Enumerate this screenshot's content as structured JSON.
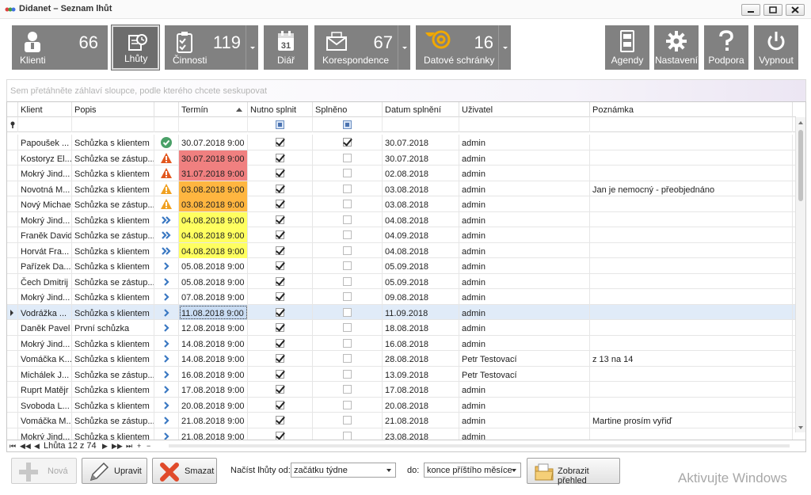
{
  "window": {
    "title": "Didanet – Seznam lhůt"
  },
  "toolbar": {
    "klienti": {
      "label": "Klienti",
      "count": "66"
    },
    "lhuty": {
      "label": "Lhůty"
    },
    "cinnosti": {
      "label": "Činnosti",
      "count": "119"
    },
    "diar": {
      "label": "Diář",
      "day": "31"
    },
    "korespondence": {
      "label": "Korespondence",
      "count": "67"
    },
    "datove": {
      "label": "Datové schránky",
      "count": "16"
    },
    "agendy": {
      "label": "Agendy"
    },
    "nastaveni": {
      "label": "Nastavení"
    },
    "podpora": {
      "label": "Podpora"
    },
    "vypnout": {
      "label": "Vypnout"
    }
  },
  "grid": {
    "group_hint": "Sem přetáhněte záhlaví sloupce, podle kterého chcete seskupovat",
    "columns": {
      "klient": "Klient",
      "popis": "Popis",
      "termin": "Termín",
      "nutno": "Nutno splnit",
      "splneno": "Splněno",
      "datum": "Datum splnění",
      "uzivatel": "Uživatel",
      "poznamka": "Poznámka"
    },
    "rows": [
      {
        "klient": "Papoušek ...",
        "popis": "Schůzka s klientem",
        "status": "done",
        "termin": "30.07.2018 9:00",
        "hl": "",
        "nutno": true,
        "splneno": true,
        "datum": "30.07.2018",
        "uzivatel": "admin",
        "poznamka": ""
      },
      {
        "klient": "Kostoryz El...",
        "popis": "Schůzka se zástup...",
        "status": "overdue",
        "termin": "30.07.2018 9:00",
        "hl": "red",
        "nutno": true,
        "splneno": false,
        "datum": "30.07.2018",
        "uzivatel": "admin",
        "poznamka": ""
      },
      {
        "klient": "Mokrý Jind...",
        "popis": "Schůzka s klientem",
        "status": "overdue",
        "termin": "31.07.2018 9:00",
        "hl": "red",
        "nutno": true,
        "splneno": false,
        "datum": "02.08.2018",
        "uzivatel": "admin",
        "poznamka": ""
      },
      {
        "klient": "Novotná M...",
        "popis": "Schůzka s klientem",
        "status": "warning",
        "termin": "03.08.2018 9:00",
        "hl": "orange",
        "nutno": true,
        "splneno": false,
        "datum": "03.08.2018",
        "uzivatel": "admin",
        "poznamka": "Jan je nemocný - přeobjednáno"
      },
      {
        "klient": "Nový Michael",
        "popis": "Schůzka se zástup...",
        "status": "warning",
        "termin": "03.08.2018 9:00",
        "hl": "orange",
        "nutno": true,
        "splneno": false,
        "datum": "03.08.2018",
        "uzivatel": "admin",
        "poznamka": ""
      },
      {
        "klient": "Mokrý Jind...",
        "popis": "Schůzka s klientem",
        "status": "soon",
        "termin": "04.08.2018 9:00",
        "hl": "yellow",
        "nutno": true,
        "splneno": false,
        "datum": "04.08.2018",
        "uzivatel": "admin",
        "poznamka": ""
      },
      {
        "klient": "Franěk David",
        "popis": "Schůzka se zástup...",
        "status": "soon",
        "termin": "04.08.2018 9:00",
        "hl": "yellow",
        "nutno": true,
        "splneno": false,
        "datum": "04.09.2018",
        "uzivatel": "admin",
        "poznamka": ""
      },
      {
        "klient": "Horvát Fra...",
        "popis": "Schůzka s klientem",
        "status": "soon",
        "termin": "04.08.2018 9:00",
        "hl": "yellow",
        "nutno": true,
        "splneno": false,
        "datum": "04.08.2018",
        "uzivatel": "admin",
        "poznamka": ""
      },
      {
        "klient": "Pařízek Da...",
        "popis": "Schůzka s klientem",
        "status": "future",
        "termin": "05.08.2018 9:00",
        "hl": "",
        "nutno": true,
        "splneno": false,
        "datum": "05.09.2018",
        "uzivatel": "admin",
        "poznamka": ""
      },
      {
        "klient": "Čech Dmitrij",
        "popis": "Schůzka se zástup...",
        "status": "future",
        "termin": "05.08.2018 9:00",
        "hl": "",
        "nutno": true,
        "splneno": false,
        "datum": "05.09.2018",
        "uzivatel": "admin",
        "poznamka": ""
      },
      {
        "klient": "Mokrý Jind...",
        "popis": "Schůzka s klientem",
        "status": "future",
        "termin": "07.08.2018 9:00",
        "hl": "",
        "nutno": true,
        "splneno": false,
        "datum": "09.08.2018",
        "uzivatel": "admin",
        "poznamka": ""
      },
      {
        "klient": "Vodrážka ...",
        "popis": "Schůzka s klientem",
        "status": "future",
        "termin": "11.08.2018 9:00",
        "hl": "focus",
        "nutno": true,
        "splneno": false,
        "datum": "11.09.2018",
        "uzivatel": "admin",
        "poznamka": "",
        "selected": true
      },
      {
        "klient": "Daněk Pavel",
        "popis": "První schůzka",
        "status": "future",
        "termin": "12.08.2018 9:00",
        "hl": "",
        "nutno": true,
        "splneno": false,
        "datum": "18.08.2018",
        "uzivatel": "admin",
        "poznamka": ""
      },
      {
        "klient": "Mokrý Jind...",
        "popis": "Schůzka s klientem",
        "status": "future",
        "termin": "14.08.2018 9:00",
        "hl": "",
        "nutno": true,
        "splneno": false,
        "datum": "16.08.2018",
        "uzivatel": "admin",
        "poznamka": ""
      },
      {
        "klient": "Vomáčka K...",
        "popis": "Schůzka s klientem",
        "status": "future",
        "termin": "14.08.2018 9:00",
        "hl": "",
        "nutno": true,
        "splneno": false,
        "datum": "28.08.2018",
        "uzivatel": "Petr Testovací",
        "poznamka": "z 13 na 14"
      },
      {
        "klient": "Michálek J...",
        "popis": "Schůzka se zástup...",
        "status": "future",
        "termin": "16.08.2018 9:00",
        "hl": "",
        "nutno": true,
        "splneno": false,
        "datum": "13.09.2018",
        "uzivatel": "Petr Testovací",
        "poznamka": ""
      },
      {
        "klient": "Ruprt Matějr",
        "popis": "Schůzka s klientem",
        "status": "future",
        "termin": "17.08.2018 9:00",
        "hl": "",
        "nutno": true,
        "splneno": false,
        "datum": "17.08.2018",
        "uzivatel": "admin",
        "poznamka": ""
      },
      {
        "klient": "Svoboda L...",
        "popis": "Schůzka s klientem",
        "status": "future",
        "termin": "20.08.2018 9:00",
        "hl": "",
        "nutno": true,
        "splneno": false,
        "datum": "20.08.2018",
        "uzivatel": "admin",
        "poznamka": ""
      },
      {
        "klient": "Vomáčka M...",
        "popis": "Schůzka se zástup...",
        "status": "future",
        "termin": "21.08.2018 9:00",
        "hl": "",
        "nutno": true,
        "splneno": false,
        "datum": "21.08.2018",
        "uzivatel": "admin",
        "poznamka": "Martine prosím vyřiď"
      },
      {
        "klient": "Mokrý Jind...",
        "popis": "Schůzka s klientem",
        "status": "future",
        "termin": "21.08.2018 9:00",
        "hl": "",
        "nutno": true,
        "splneno": false,
        "datum": "23.08.2018",
        "uzivatel": "admin",
        "poznamka": ""
      }
    ],
    "navigator": "Lhůta 12 z 74"
  },
  "bottom": {
    "nova": "Nová",
    "upravit": "Upravit",
    "smazat": "Smazat",
    "nacist_label": "Načíst lhůty od:",
    "od_value": "začátku týdne",
    "do_label": "do:",
    "do_value": "konce příštího měsíce",
    "prehled": "Zobrazit přehled",
    "watermark": "Aktivujte Windows"
  },
  "colors": {
    "toolbar_bg": "#818181",
    "overdue": "#f08080",
    "warning": "#ffb640",
    "soon": "#ffff60",
    "selected_row": "#e0ebf8"
  }
}
